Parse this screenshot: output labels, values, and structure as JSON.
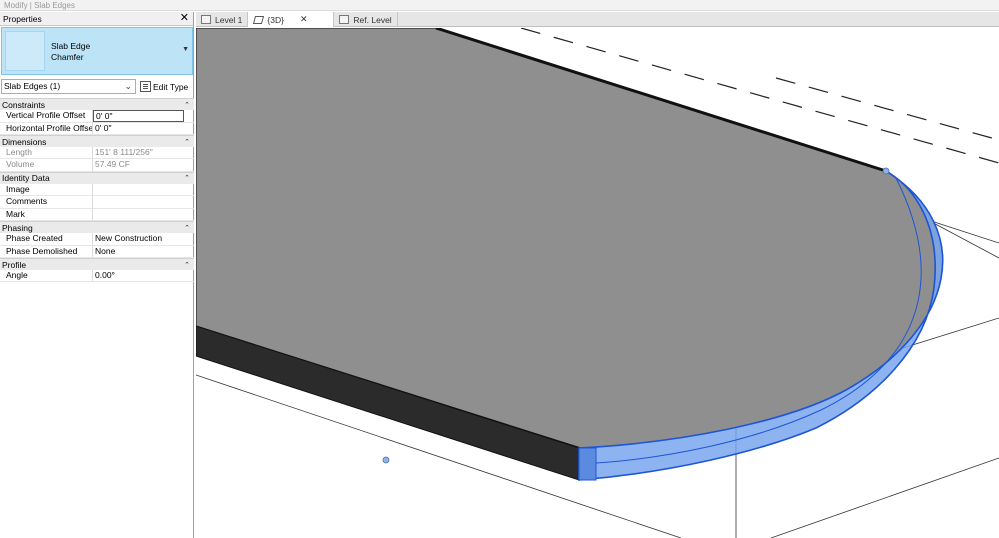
{
  "titlebar": {
    "text": "Modify | Slab Edges"
  },
  "properties": {
    "title": "Properties",
    "close_glyph": "✕",
    "type_selector": {
      "family": "Slab Edge",
      "type": "Chamfer",
      "dropdown_icon": "triangle-down-icon"
    },
    "filter": {
      "value": "Slab Edges (1)",
      "arrow_icon": "chevron-down-icon"
    },
    "edit_type_label": "Edit Type",
    "groups": [
      {
        "name": "Constraints",
        "rows": [
          {
            "key": "Vertical Profile Offset",
            "value": "0'  0\""
          },
          {
            "key": "Horizontal Profile Offset",
            "value": "0'  0\""
          }
        ]
      },
      {
        "name": "Dimensions",
        "rows": [
          {
            "key": "Length",
            "value": "151'  8 111/256\""
          },
          {
            "key": "Volume",
            "value": "57.49 CF"
          }
        ]
      },
      {
        "name": "Identity Data",
        "rows": [
          {
            "key": "Image",
            "value": ""
          },
          {
            "key": "Comments",
            "value": ""
          },
          {
            "key": "Mark",
            "value": ""
          }
        ]
      },
      {
        "name": "Phasing",
        "rows": [
          {
            "key": "Phase Created",
            "value": "New Construction"
          },
          {
            "key": "Phase Demolished",
            "value": "None"
          }
        ]
      },
      {
        "name": "Profile",
        "rows": [
          {
            "key": "Angle",
            "value": "0.00°"
          }
        ]
      }
    ]
  },
  "tabs": [
    {
      "label": "Level 1"
    },
    {
      "label": "{3D}",
      "close_glyph": "✕"
    },
    {
      "label": "Ref. Level"
    }
  ],
  "viewport": {
    "slab_color": "#8c8c8c",
    "edge_color": "#2a2a2a",
    "selection_color": "#2f6fe0",
    "selection_fill": "#7aa6ef"
  }
}
